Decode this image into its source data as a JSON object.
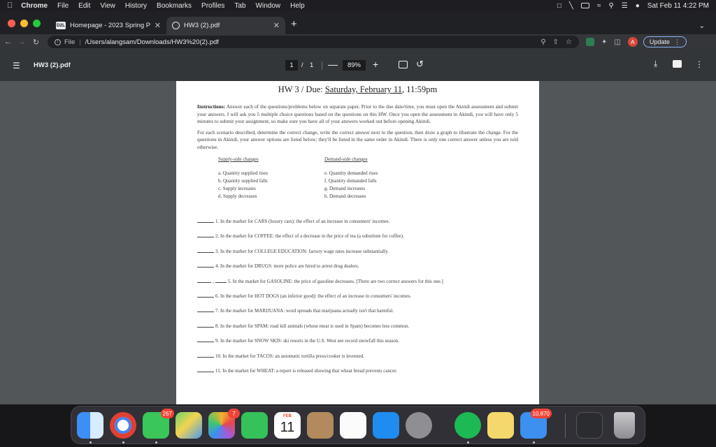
{
  "menubar": {
    "app": "Chrome",
    "items": [
      "File",
      "Edit",
      "View",
      "History",
      "Bookmarks",
      "Profiles",
      "Tab",
      "Window",
      "Help"
    ],
    "datetime": "Sat Feb 11  4:22 PM"
  },
  "tabs": [
    {
      "favicon": "D2L",
      "title": "Homepage - 2023 Spring Prin"
    },
    {
      "favicon": "globe-icon",
      "title": "HW3 (2).pdf"
    }
  ],
  "toolbar": {
    "scheme": "File",
    "url": "/Users/alangsam/Downloads/HW3%20(2).pdf",
    "avatar_letter": "A",
    "update_label": "Update"
  },
  "pdf": {
    "filename": "HW3 (2).pdf",
    "current_page": "1",
    "page_sep": "/",
    "total_pages": "1",
    "zoom": "89%"
  },
  "document": {
    "title_prefix": "HW 3 / Due: ",
    "title_due": "Saturday, February 11",
    "title_time": ", 11:59pm",
    "instructions_label": "Instructions:",
    "instructions_text": " Answer each of the questions/problems below on separate paper. Prior to the due date/time, you must open the Akindi assessment and submit your answers. I will ask you 5 multiple choice questions based on the questions on this HW. Once you open the assessment in Akindi, you will have only 5 minutes to submit your assignment, so make sure you have all of your answers worked out before opening Akindi.",
    "scenario_text": "For each scenario described, determine the correct change, write the correct answer next to the question, then draw a graph to illustrate the change. For the questions in Akindi, your answer options are listed below; they'll be listed in the same order in Akindi. There is only one correct answer unless you are told otherwise.",
    "supply_header": "Supply-side changes",
    "supply_items": [
      "a.   Quantity supplied rises",
      "b.   Quantity supplied falls",
      "c.   Supply increases",
      "d.   Supply decreases"
    ],
    "demand_header": "Demand-side changes",
    "demand_items": [
      "e.   Quantity demanded rises",
      "f.   Quantity demanded falls",
      "g.   Demand increases",
      "h.   Demand decreases"
    ],
    "questions": [
      "1. In the market for CARS (luxury cars): the effect of an increase in consumers' incomes.",
      "2. In the market for COFFEE: the effect of a decrease in the price of tea (a substitute for coffee).",
      "3. In the market for COLLEGE EDUCATION: factory wage rates increase substantially.",
      "4. In the market for DRUGS: more police are hired to arrest drug dealers.",
      "5. In the market for GASOLINE: the price of gasoline decreases. [There are two correct answers for this one.]",
      "6. In the market for HOT DOGS (an inferior good): the effect of an increase in consumers' incomes.",
      "7. In the market for MARIJUANA: word spreads that marijuana actually isn't that harmful.",
      "8. In the market for SPAM: road kill animals (whose meat is used in Spam) becomes less common.",
      "9. In the market for SNOW SKIS: ski resorts in the U.S. West see record snowfall this season.",
      "10. In the market for TACOS: an automatic tortilla press/cooker is invented.",
      "11. In the market for WHEAT: a report is released showing that wheat bread prevents cancer."
    ]
  },
  "dock": {
    "messages_badge": "267",
    "photos_badge": "7",
    "calendar_month": "FEB",
    "calendar_day": "11",
    "mail_badge": "10,870"
  },
  "colors": {
    "pdf_toolbar": "#323639",
    "viewer_bg": "#525659",
    "chrome_tabstrip": "#202124",
    "chrome_toolbar": "#35363a",
    "update_border": "#8ab4f8",
    "badge_red": "#f04437"
  }
}
